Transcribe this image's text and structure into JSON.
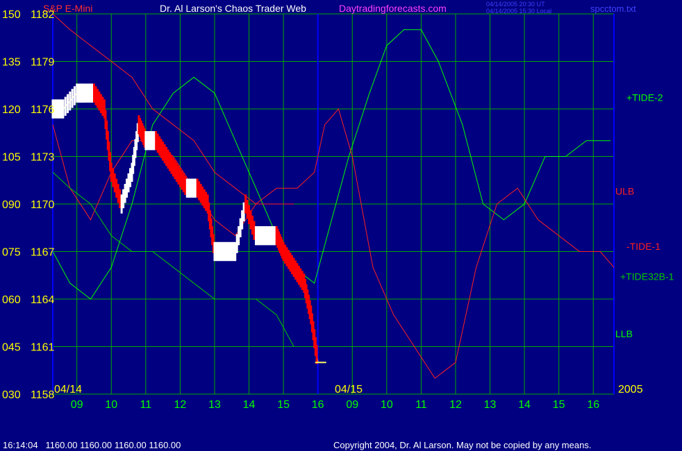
{
  "header": {
    "title_left": "S&P E-Mini",
    "title_main": "Dr. Al Larson's Chaos Trader Web",
    "site": "Daytradingforecasts.com",
    "timestamp_ut": "04/14/2005 20:30 UT",
    "timestamp_local": "04/14/2005 15:30 Local",
    "file": "spcctom.txt"
  },
  "footer": {
    "quote": "16:14:04   1160.00 1160.00 1160.00 1160.00",
    "copyright": "Copyright 2004, Dr. Al Larson. May not be copied by any means."
  },
  "colors": {
    "background": "#000080",
    "grid": "#00a800",
    "axis": "#0000ff",
    "price_label": "#ffff00",
    "time_label": "#00ff00",
    "tide": "#00ff00",
    "tide32b": "#00c800",
    "bands": "#ff2020",
    "legend_ulb": "#ff2020",
    "legend_llb": "#00ff00",
    "moving_avg": "#ffff60",
    "trend": "#3030ff",
    "up_bar": "#ffffff",
    "down_bar": "#ff0000",
    "title_left": "#ff3030",
    "title_main": "#ffffff",
    "site": "#ff40ff",
    "timestamp": "#4040ff",
    "file": "#4040ff",
    "footer": "#ffffff"
  },
  "chart_data": {
    "type": "line",
    "y_left": {
      "label": "",
      "ticks": [
        "150",
        "135",
        "120",
        "105",
        "090",
        "075",
        "060",
        "045",
        "030"
      ]
    },
    "y_right": {
      "label": "",
      "ticks": [
        "1182",
        "1179",
        "1176",
        "1173",
        "1170",
        "1167",
        "1164",
        "1161",
        "1158"
      ],
      "ylim": [
        1158,
        1182
      ]
    },
    "x_ticks": [
      "09",
      "10",
      "11",
      "12",
      "13",
      "14",
      "15",
      "16",
      "09",
      "10",
      "11",
      "12",
      "13",
      "14",
      "15",
      "16"
    ],
    "date_labels": [
      "04/14",
      "04/15",
      "2005"
    ],
    "grid": true,
    "legend": [
      "+TIDE-2",
      "ULB",
      "-TIDE-1",
      "+TIDE32B-1",
      "LLB"
    ],
    "series": [
      {
        "name": "+TIDE-2",
        "x": [
          8.3,
          8.8,
          9.4,
          10.0,
          10.6,
          11.2,
          11.8,
          12.4,
          13.0,
          13.6,
          14.2,
          14.8,
          15.3,
          15.9,
          16.9,
          17.5,
          18.0,
          18.5,
          19.0,
          19.5,
          20.2,
          20.8,
          21.4,
          22.0,
          22.6,
          23.2,
          23.8,
          24.2,
          24.5
        ],
        "y": [
          1167,
          1165,
          1164,
          1166,
          1170,
          1175,
          1177,
          1178,
          1177,
          1174,
          1171,
          1168,
          1166,
          1165,
          1173,
          1177,
          1180,
          1181,
          1181,
          1179,
          1175,
          1170,
          1169,
          1170,
          1173,
          1173,
          1174,
          1174,
          1174
        ]
      },
      {
        "name": "ULB",
        "x": [
          8.3,
          8.8,
          9.4,
          10.0,
          10.6,
          11.2,
          11.8,
          12.4,
          13.0,
          13.6,
          14.2,
          14.8,
          15.4,
          15.9,
          16.2,
          16.6,
          17.0,
          17.6,
          18.2,
          18.8,
          19.4,
          20.0,
          20.6,
          21.2,
          21.8,
          22.4,
          23.0,
          23.6,
          24.2,
          24.6
        ],
        "y": [
          1175,
          1171,
          1169,
          1172,
          1174,
          1174,
          1173,
          1171,
          1169,
          1168,
          1170,
          1171,
          1171,
          1172,
          1175,
          1176,
          1173,
          1166,
          1163,
          1161,
          1159,
          1160,
          1166,
          1170,
          1171,
          1169,
          1168,
          1167,
          1167,
          1166
        ]
      },
      {
        "name": "-TIDE-1",
        "x": [
          8.3,
          8.8,
          9.4,
          10.0,
          10.6,
          11.2,
          11.8,
          12.4,
          13.0,
          13.6,
          14.2,
          14.8,
          15.3
        ],
        "y": [
          1182,
          1181,
          1180,
          1179,
          1178,
          1176,
          1175,
          1174,
          1172,
          1171,
          1170,
          1170,
          1170
        ]
      },
      {
        "name": "LLB",
        "x": [
          8.3,
          8.8,
          9.4,
          10.0,
          10.6,
          11.2,
          11.8,
          12.4,
          13.0,
          13.6,
          14.2,
          14.8,
          15.3
        ],
        "y": [
          1172,
          1171,
          1170,
          1168,
          1167,
          1167,
          1166,
          1165,
          1164,
          1164,
          1164,
          1163,
          1161
        ]
      },
      {
        "name": "S&P E-Mini",
        "x": [
          8.3,
          8.6,
          9.0,
          9.2,
          9.5,
          9.8,
          10.0,
          10.3,
          10.6,
          10.8,
          11.0,
          11.3,
          11.6,
          11.9,
          12.2,
          12.5,
          12.8,
          13.0,
          13.3,
          13.6,
          13.9,
          14.2,
          14.5,
          14.8,
          15.0,
          15.3,
          15.6,
          15.8,
          16.0
        ],
        "y": [
          1176,
          1176,
          1177,
          1177,
          1177,
          1176,
          1172,
          1170,
          1172,
          1175,
          1174,
          1174,
          1173,
          1172,
          1171,
          1171,
          1170,
          1167,
          1167,
          1167,
          1170,
          1168,
          1168,
          1168,
          1167,
          1166,
          1165,
          1163,
          1160
        ]
      }
    ],
    "last_price": 1160.0
  }
}
